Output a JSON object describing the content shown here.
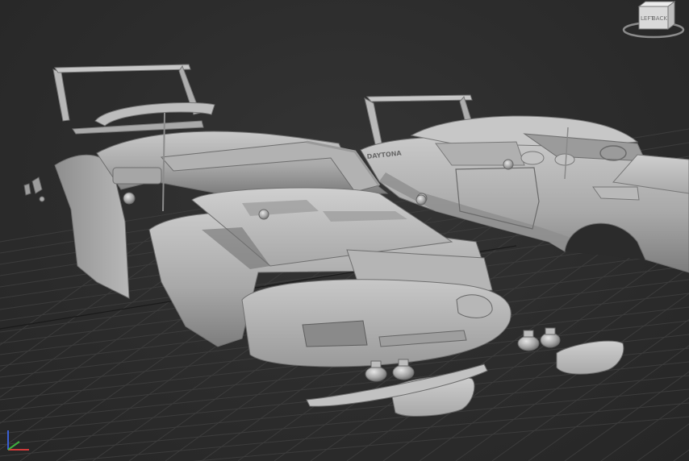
{
  "viewport": {
    "background": "#2b2b2b",
    "grid_color": "#3c3c3c",
    "model_color": "#b3b3b3",
    "shadow_color": "#6c6c6c"
  },
  "viewcube": {
    "face_label": "LEFT BACK",
    "label_front": "LEFT",
    "label_side": "BACK",
    "icon": "viewcube-icon"
  },
  "axis_gizmo": {
    "icon": "axis-tripod-icon",
    "x_color": "#d23a3a",
    "y_color": "#3fae3f",
    "z_color": "#3a5fd2"
  },
  "model": {
    "decal_text": "DAYTONA",
    "parts": [
      "exploded-car-body",
      "assembled-car-body",
      "rear-wing-left",
      "rear-wing-right",
      "nose-cone",
      "front-bumper",
      "headlight-bucket-left",
      "headlight-bucket-right",
      "headlight-cover-left",
      "headlight-cover-right",
      "windshield-frame",
      "rear-window-frame"
    ]
  }
}
